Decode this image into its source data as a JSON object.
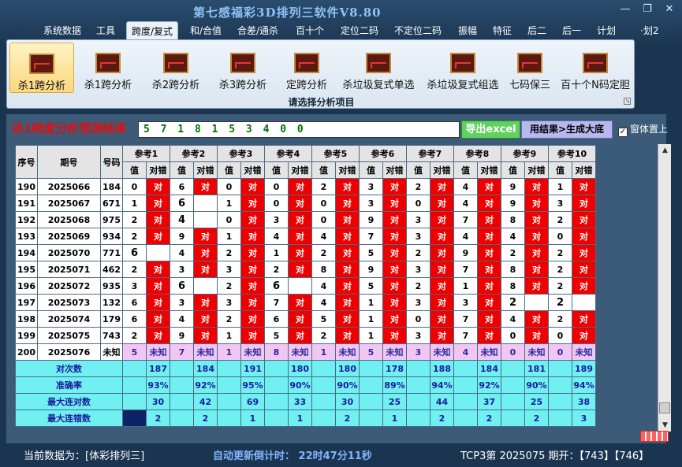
{
  "title": "第七感福彩3D排列三软件V8.80",
  "window_buttons": {
    "minimize": "—",
    "restore": "❐",
    "close": "✕"
  },
  "menu": [
    "系统数据",
    "工具",
    "跨度/复式",
    "和/合值",
    "合差/通杀",
    "百十个",
    "定位二码",
    "不定位二码",
    "振幅",
    "特征",
    "后二",
    "后一",
    "计划",
    "·划2"
  ],
  "ribbon": {
    "buttons": [
      "杀1跨分析",
      "杀1跨分析",
      "杀2跨分析",
      "杀3跨分析",
      "定跨分析",
      "杀垃圾复式单选",
      "杀垃圾复式组选",
      "七码保三",
      "百十个N码定胆"
    ],
    "caption": "请选择分析项目",
    "corner": "↘"
  },
  "result": {
    "label": "杀1跨度分析预测结果",
    "value": "5 7 1 8 1 5 3 4 0 0",
    "excel_button": "导出excel",
    "generate_button": "用结果>生成大底",
    "ontop_label": "窗体置上",
    "ontop_checked": "✓"
  },
  "table": {
    "col_seq": "序号",
    "col_period": "期号",
    "col_num": "号码",
    "refs": [
      "参考1",
      "参考2",
      "参考3",
      "参考4",
      "参考5",
      "参考6",
      "参考7",
      "参考8",
      "参考9",
      "参考10"
    ],
    "sub_val": "值",
    "sub_ok": "对错",
    "ok_text": "对",
    "rows": [
      {
        "seq": "190",
        "period": "2025066",
        "num": "184",
        "v": [
          "0",
          "6",
          "0",
          "0",
          "2",
          "3",
          "2",
          "4",
          "9",
          "1"
        ],
        "r": [
          1,
          1,
          1,
          1,
          1,
          1,
          1,
          1,
          1,
          1
        ]
      },
      {
        "seq": "191",
        "period": "2025067",
        "num": "671",
        "v": [
          "1",
          "6",
          "1",
          "0",
          "0",
          "3",
          "0",
          "4",
          "9",
          "3"
        ],
        "r": [
          1,
          0,
          1,
          1,
          1,
          1,
          1,
          1,
          1,
          1
        ]
      },
      {
        "seq": "192",
        "period": "2025068",
        "num": "975",
        "v": [
          "2",
          "4",
          "0",
          "3",
          "0",
          "9",
          "3",
          "7",
          "8",
          "2"
        ],
        "r": [
          1,
          0,
          1,
          1,
          1,
          1,
          1,
          1,
          1,
          1
        ]
      },
      {
        "seq": "193",
        "period": "2025069",
        "num": "934",
        "v": [
          "2",
          "9",
          "1",
          "4",
          "4",
          "7",
          "3",
          "4",
          "4",
          "0"
        ],
        "r": [
          1,
          1,
          1,
          1,
          1,
          1,
          1,
          1,
          1,
          1
        ]
      },
      {
        "seq": "194",
        "period": "2025070",
        "num": "771",
        "v": [
          "6",
          "4",
          "2",
          "1",
          "2",
          "5",
          "2",
          "9",
          "2",
          "2"
        ],
        "r": [
          0,
          1,
          1,
          1,
          1,
          1,
          1,
          1,
          1,
          1
        ]
      },
      {
        "seq": "195",
        "period": "2025071",
        "num": "462",
        "v": [
          "2",
          "3",
          "3",
          "2",
          "8",
          "9",
          "3",
          "7",
          "8",
          "2"
        ],
        "r": [
          1,
          1,
          1,
          1,
          1,
          1,
          1,
          1,
          1,
          1
        ]
      },
      {
        "seq": "196",
        "period": "2025072",
        "num": "935",
        "v": [
          "3",
          "6",
          "2",
          "6",
          "4",
          "5",
          "2",
          "1",
          "8",
          "2"
        ],
        "r": [
          1,
          0,
          1,
          0,
          1,
          1,
          1,
          1,
          1,
          1
        ]
      },
      {
        "seq": "197",
        "period": "2025073",
        "num": "132",
        "v": [
          "6",
          "3",
          "3",
          "7",
          "4",
          "1",
          "3",
          "3",
          "2",
          "2"
        ],
        "r": [
          1,
          1,
          1,
          1,
          1,
          1,
          1,
          1,
          0,
          0
        ]
      },
      {
        "seq": "198",
        "period": "2025074",
        "num": "179",
        "v": [
          "6",
          "4",
          "2",
          "6",
          "5",
          "1",
          "0",
          "7",
          "4",
          "2"
        ],
        "r": [
          1,
          1,
          1,
          1,
          1,
          1,
          1,
          1,
          1,
          1
        ]
      },
      {
        "seq": "199",
        "period": "2025075",
        "num": "743",
        "v": [
          "2",
          "9",
          "1",
          "5",
          "2",
          "1",
          "3",
          "7",
          "0",
          "0"
        ],
        "r": [
          1,
          1,
          1,
          1,
          1,
          1,
          1,
          1,
          1,
          1
        ]
      }
    ],
    "predict": {
      "seq": "200",
      "period": "2025076",
      "num": "未知",
      "v": [
        "5",
        "7",
        "1",
        "8",
        "1",
        "5",
        "3",
        "4",
        "0",
        "0"
      ],
      "r": "未知"
    },
    "stats": [
      {
        "label": "对次数",
        "values": [
          "187",
          "184",
          "191",
          "180",
          "180",
          "178",
          "188",
          "184",
          "181",
          "189"
        ]
      },
      {
        "label": "准确率",
        "values": [
          "93%",
          "92%",
          "95%",
          "90%",
          "90%",
          "89%",
          "94%",
          "92%",
          "90%",
          "94%"
        ]
      },
      {
        "label": "最大连对数",
        "values": [
          "30",
          "42",
          "69",
          "33",
          "30",
          "25",
          "44",
          "37",
          "25",
          "38"
        ]
      },
      {
        "label": "最大连错数",
        "values": [
          "2",
          "2",
          "1",
          "1",
          "2",
          "1",
          "2",
          "2",
          "2",
          "3"
        ]
      }
    ]
  },
  "status": {
    "current": "当前数据为：[体彩排列三]",
    "countdown": "自动更新倒计时： 22时47分11秒",
    "draw": "TCP3第 2025075 期开：【743】【746】"
  }
}
